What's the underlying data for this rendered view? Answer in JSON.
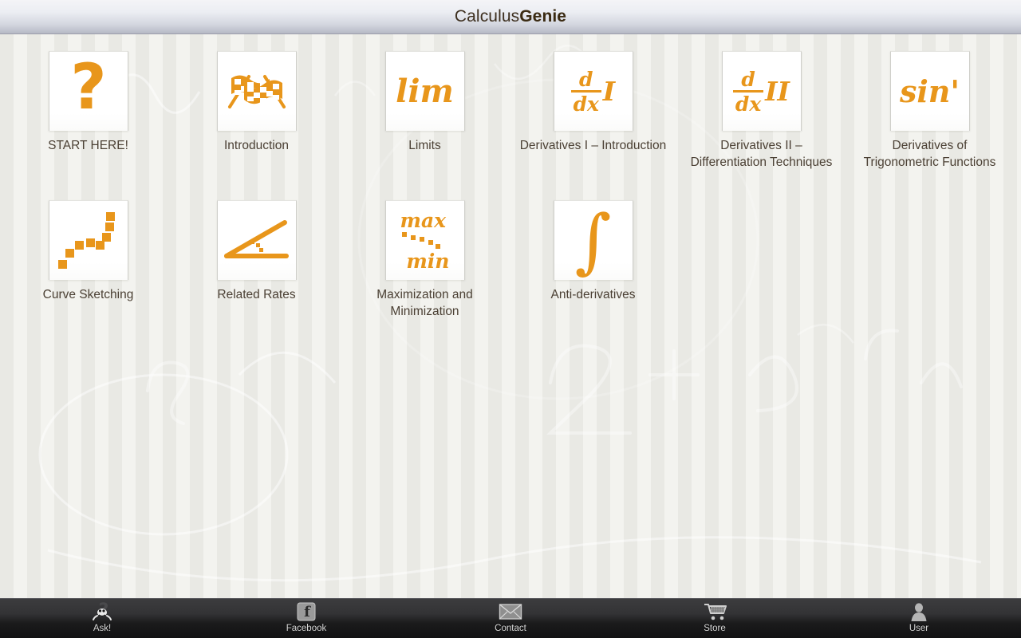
{
  "header": {
    "title_regular": "Calculus",
    "title_bold": "Genie"
  },
  "theme": {
    "accent_orange": "#e8961b",
    "label_text": "#4b4034",
    "tile_background": "#ffffff",
    "nav_background": "#1b1b1c",
    "nav_text": "#d8d8d8",
    "page_background": "#eeeee9"
  },
  "tiles": [
    {
      "label": "START HERE!",
      "icon": "question-mark-icon"
    },
    {
      "label": "Introduction",
      "icon": "checkered-flags-icon"
    },
    {
      "label": "Limits",
      "icon": "lim-icon"
    },
    {
      "label": "Derivatives I – Introduction",
      "icon": "d-dx-one-icon"
    },
    {
      "label": "Derivatives II –\nDifferentiation Techniques",
      "icon": "d-dx-two-icon"
    },
    {
      "label": "Derivatives of\nTrigonometric Functions",
      "icon": "sin-prime-icon"
    },
    {
      "label": "Curve Sketching",
      "icon": "dotted-curve-icon"
    },
    {
      "label": "Related Rates",
      "icon": "angle-icon"
    },
    {
      "label": "Maximization and\nMinimization",
      "icon": "max-min-icon"
    },
    {
      "label": "Anti-derivatives",
      "icon": "integral-icon"
    }
  ],
  "tile_math": {
    "lim": "lim",
    "d": "d",
    "dx": "dx",
    "roman_one": "I",
    "roman_two": "II",
    "sin_prime": "sin'",
    "max": "max",
    "min": "min",
    "integral": "∫"
  },
  "bottom_nav": [
    {
      "label": "Ask!",
      "icon": "genie-icon"
    },
    {
      "label": "Facebook",
      "icon": "facebook-icon"
    },
    {
      "label": "Contact",
      "icon": "envelope-icon"
    },
    {
      "label": "Store",
      "icon": "shopping-cart-icon"
    },
    {
      "label": "User",
      "icon": "user-icon"
    }
  ]
}
